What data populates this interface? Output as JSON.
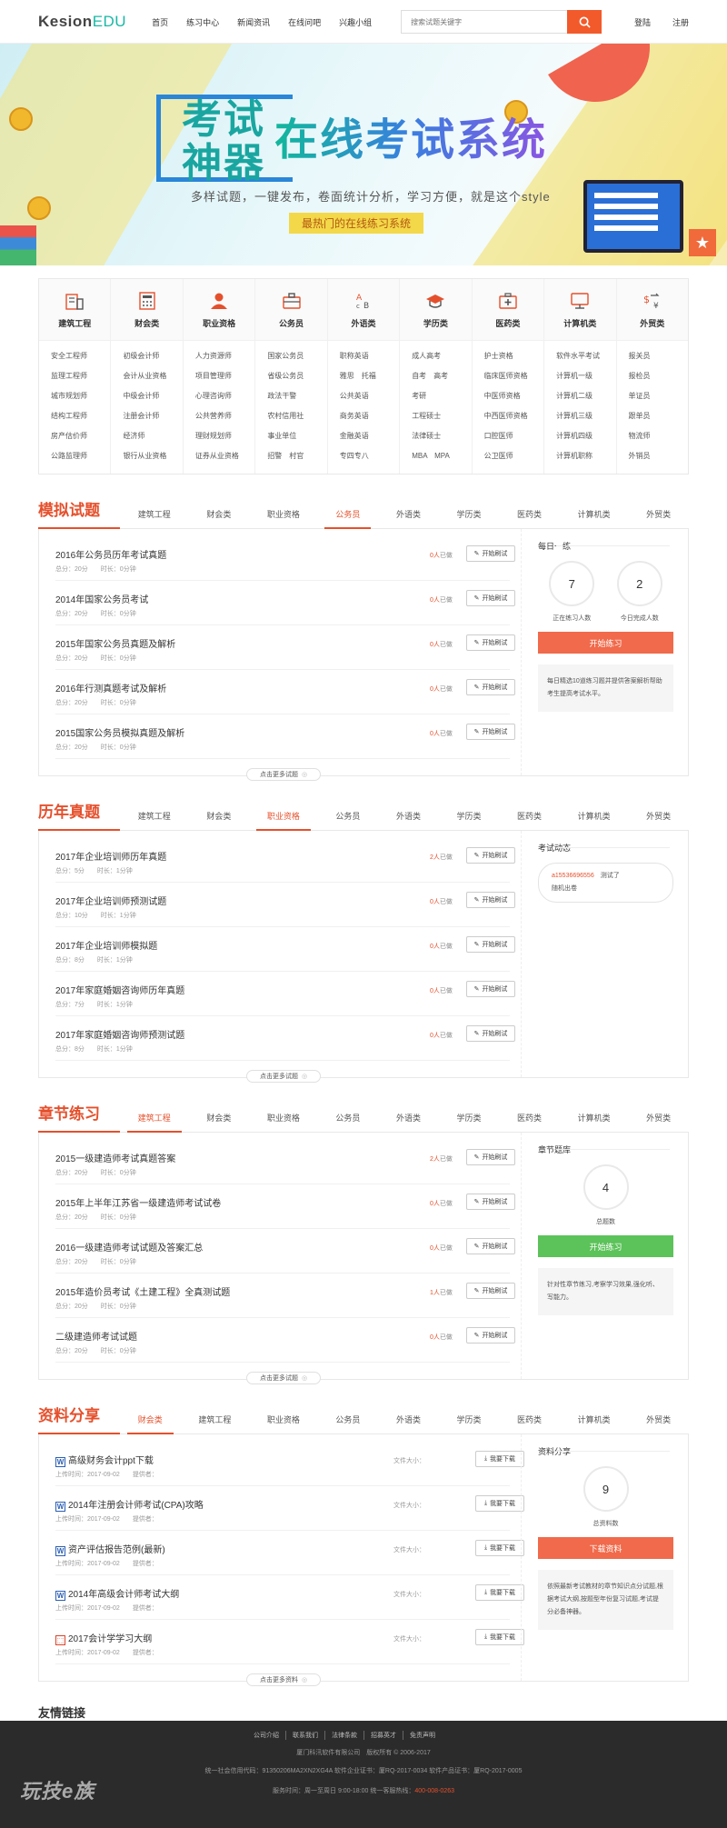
{
  "header": {
    "logo_main": "Kesion",
    "logo_accent": "EDU",
    "nav": [
      "首页",
      "练习中心",
      "新闻资讯",
      "在线问吧",
      "兴趣小组"
    ],
    "search_placeholder": "搜索试题关键字",
    "login": "登陆",
    "register": "注册"
  },
  "banner": {
    "line1": "考试",
    "line2": "神器",
    "headline": "在线考试系统",
    "subtitle": "多样试题，一键发布，卷面统计分析，学习方便，就是这个style",
    "tag": "最热门的在线练习系统"
  },
  "categories": [
    {
      "name": "建筑工程",
      "icon": "building-icon",
      "links": [
        "安全工程师",
        "监理工程师",
        "城市规划师",
        "结构工程师",
        "房产估价师",
        "公路监理师"
      ]
    },
    {
      "name": "财会类",
      "icon": "calculator-icon",
      "links": [
        "初级会计师",
        "会计从业资格",
        "中级会计师",
        "注册会计师",
        "经济师",
        "银行从业资格"
      ]
    },
    {
      "name": "职业资格",
      "icon": "person-icon",
      "links": [
        "人力资源师",
        "项目管理师",
        "心理咨询师",
        "公共营养师",
        "理财规划师",
        "证券从业资格"
      ]
    },
    {
      "name": "公务员",
      "icon": "briefcase-icon",
      "links": [
        "国家公务员",
        "省级公务员",
        "政法干警",
        "农村信用社",
        "事业单位",
        "招警　村官"
      ]
    },
    {
      "name": "外语类",
      "icon": "abc-icon",
      "links": [
        "职称英语",
        "雅思　托福",
        "公共英语",
        "商务英语",
        "金融英语",
        "专四专八"
      ]
    },
    {
      "name": "学历类",
      "icon": "graduation-cap-icon",
      "links": [
        "成人高考",
        "自考　高考",
        "考研",
        "工程硕士",
        "法律硕士",
        "MBA　MPA"
      ]
    },
    {
      "name": "医药类",
      "icon": "medical-kit-icon",
      "links": [
        "护士资格",
        "临床医师资格",
        "中医师资格",
        "中西医师资格",
        "口腔医师",
        "公卫医师"
      ]
    },
    {
      "name": "计算机类",
      "icon": "monitor-icon",
      "links": [
        "软件水平考试",
        "计算机一级",
        "计算机二级",
        "计算机三级",
        "计算机四级",
        "计算机职称"
      ]
    },
    {
      "name": "外贸类",
      "icon": "currency-exchange-icon",
      "links": [
        "报关员",
        "报检员",
        "单证员",
        "跟单员",
        "物流师",
        "外销员"
      ]
    }
  ],
  "sections": {
    "mock": {
      "title": "模拟试题",
      "tabs": [
        "建筑工程",
        "财会类",
        "职业资格",
        "公务员",
        "外语类",
        "学历类",
        "医药类",
        "计算机类",
        "外贸类"
      ],
      "active_tab": "公务员",
      "items": [
        {
          "title": "2016年公务员历年考试真题",
          "score": "总分：20分",
          "time": "时长：0分钟",
          "count": "0人",
          "count_suffix": "已做",
          "btn": "开始刷试"
        },
        {
          "title": "2014年国家公务员考试",
          "score": "总分：20分",
          "time": "时长：0分钟",
          "count": "0人",
          "count_suffix": "已做",
          "btn": "开始刷试"
        },
        {
          "title": "2015年国家公务员真题及解析",
          "score": "总分：20分",
          "time": "时长：0分钟",
          "count": "0人",
          "count_suffix": "已做",
          "btn": "开始刷试"
        },
        {
          "title": "2016年行测真题考试及解析",
          "score": "总分：20分",
          "time": "时长：0分钟",
          "count": "0人",
          "count_suffix": "已做",
          "btn": "开始刷试"
        },
        {
          "title": "2015国家公务员模拟真题及解析",
          "score": "总分：20分",
          "time": "时长：0分钟",
          "count": "0人",
          "count_suffix": "已做",
          "btn": "开始刷试"
        }
      ],
      "more": "点击更多试题",
      "side": {
        "title": "每日一练",
        "stat1_value": "7",
        "stat1_label": "正在练习人数",
        "stat2_value": "2",
        "stat2_label": "今日完成人数",
        "button": "开始练习",
        "note": "每日精选10道练习题并提供答案解析帮助考生提高考试水平。"
      }
    },
    "past": {
      "title": "历年真题",
      "tabs": [
        "建筑工程",
        "财会类",
        "职业资格",
        "公务员",
        "外语类",
        "学历类",
        "医药类",
        "计算机类",
        "外贸类"
      ],
      "active_tab": "职业资格",
      "items": [
        {
          "title": "2017年企业培训师历年真题",
          "score": "总分：5分",
          "time": "时长：1分钟",
          "count": "2人",
          "count_suffix": "已做",
          "btn": "开始刷试"
        },
        {
          "title": "2017年企业培训师预测试题",
          "score": "总分：10分",
          "time": "时长：1分钟",
          "count": "0人",
          "count_suffix": "已做",
          "btn": "开始刷试"
        },
        {
          "title": "2017年企业培训师模拟题",
          "score": "总分：8分",
          "time": "时长：1分钟",
          "count": "0人",
          "count_suffix": "已做",
          "btn": "开始刷试"
        },
        {
          "title": "2017年家庭婚姻咨询师历年真题",
          "score": "总分：7分",
          "time": "时长：1分钟",
          "count": "0人",
          "count_suffix": "已做",
          "btn": "开始刷试"
        },
        {
          "title": "2017年家庭婚姻咨询师预测试题",
          "score": "总分：8分",
          "time": "时长：1分钟",
          "count": "0人",
          "count_suffix": "已做",
          "btn": "开始刷试"
        }
      ],
      "more": "点击更多试题",
      "side": {
        "title": "考试动态",
        "user": "a15536696556",
        "action": "测试了",
        "target": "随机出卷"
      }
    },
    "chapter": {
      "title": "章节练习",
      "tabs": [
        "建筑工程",
        "财会类",
        "职业资格",
        "公务员",
        "外语类",
        "学历类",
        "医药类",
        "计算机类",
        "外贸类"
      ],
      "active_tab": "建筑工程",
      "items": [
        {
          "title": "2015一级建造师考试真题答案",
          "score": "总分：20分",
          "time": "时长：0分钟",
          "count": "2人",
          "count_suffix": "已做",
          "btn": "开始刷试"
        },
        {
          "title": "2015年上半年江苏省一级建造师考试试卷",
          "score": "总分：20分",
          "time": "时长：0分钟",
          "count": "0人",
          "count_suffix": "已做",
          "btn": "开始刷试"
        },
        {
          "title": "2016一级建造师考试试题及答案汇总",
          "score": "总分：20分",
          "time": "时长：0分钟",
          "count": "0人",
          "count_suffix": "已做",
          "btn": "开始刷试"
        },
        {
          "title": "2015年造价员考试《土建工程》全真测试题",
          "score": "总分：20分",
          "time": "时长：0分钟",
          "count": "1人",
          "count_suffix": "已做",
          "btn": "开始刷试"
        },
        {
          "title": "二级建造师考试试题",
          "score": "总分：20分",
          "time": "时长：0分钟",
          "count": "0人",
          "count_suffix": "已做",
          "btn": "开始刷试"
        }
      ],
      "more": "点击更多试题",
      "side": {
        "title": "章节题库",
        "stat_value": "4",
        "stat_label": "总题数",
        "button": "开始练习",
        "note": "针对性章节练习,考察学习效果,强化听、写能力。"
      }
    },
    "resources": {
      "title": "资料分享",
      "tabs": [
        "财会类",
        "建筑工程",
        "职业资格",
        "公务员",
        "外语类",
        "学历类",
        "医药类",
        "计算机类",
        "外贸类"
      ],
      "active_tab": "财会类",
      "items": [
        {
          "title": "高级财务会计ppt下载",
          "icon": "word-icon",
          "date": "上传时间：2017-09-02",
          "provider": "提供者：",
          "size": "文件大小：",
          "btn": "我要下载"
        },
        {
          "title": "2014年注册会计师考试(CPA)攻略",
          "icon": "word-icon",
          "date": "上传时间：2017-09-02",
          "provider": "提供者：",
          "size": "文件大小：",
          "btn": "我要下载"
        },
        {
          "title": "资产评估报告范例(最新)",
          "icon": "word-icon",
          "date": "上传时间：2017-09-02",
          "provider": "提供者：",
          "size": "文件大小：",
          "btn": "我要下载"
        },
        {
          "title": "2014年高级会计师考试大纲",
          "icon": "word-icon",
          "date": "上传时间：2017-09-02",
          "provider": "提供者：",
          "size": "文件大小：",
          "btn": "我要下载"
        },
        {
          "title": "2017会计学学习大纲",
          "icon": "pdf-icon",
          "date": "上传时间：2017-09-02",
          "provider": "提供者：",
          "size": "文件大小：",
          "btn": "我要下载"
        }
      ],
      "more": "点击更多资料",
      "side": {
        "title": "资料分享",
        "stat_value": "9",
        "stat_label": "总资料数",
        "button": "下载资料",
        "note": "依照最新考试教材的章节知识点分试题,根据考试大纲,按题型年份复习试题,考试提分必备神器。"
      }
    }
  },
  "friend_links": {
    "title": "友情链接"
  },
  "footer": {
    "links": [
      "公司介绍",
      "联系我们",
      "法律条款",
      "招募英才",
      "免责声明"
    ],
    "company": "厦门科汛软件有限公司",
    "copyright": "版权所有 © 2006-2017",
    "license": "统一社会信用代码：91350206MA2XN2XG4A 软件企业证书：厦RQ-2017-0034 软件产品证书：厦RQ-2017-0005",
    "service_prefix": "服务时间：周一至周日 9:00-18:00 统一客服热线：",
    "phone": "400-008-0263",
    "logo": "玩技e族"
  },
  "colors": {
    "accent": "#e5502c",
    "teal": "#19b8a5",
    "green": "#5cc25a"
  }
}
